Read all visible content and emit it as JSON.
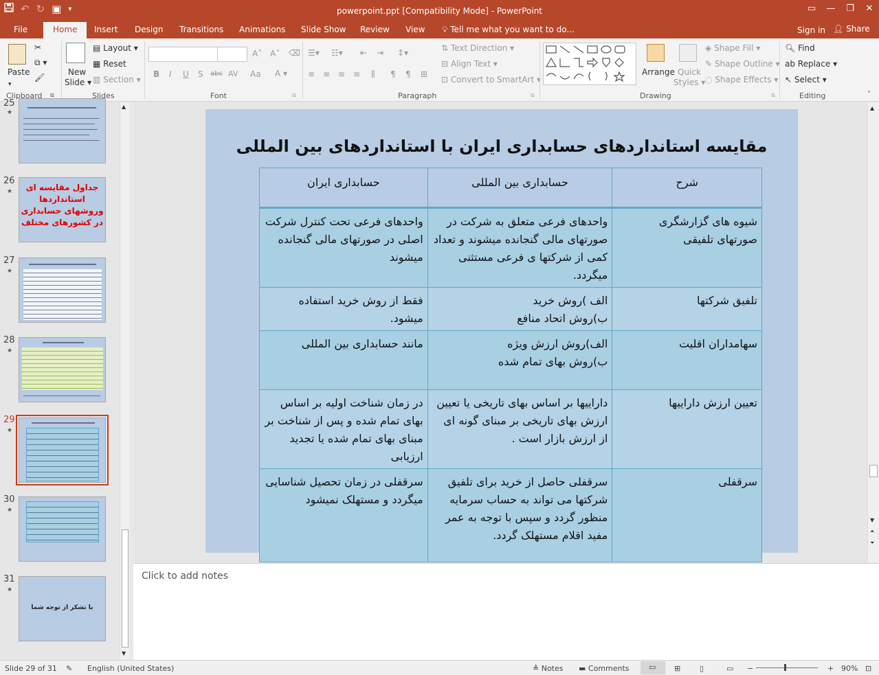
{
  "app": {
    "title": "powerpoint.ppt [Compatibility Mode] - PowerPoint",
    "accent": "#b7472a"
  },
  "qat": {
    "save_icon": "save-icon",
    "undo_icon": "undo-icon",
    "redo_icon": "redo-icon",
    "present_icon": "present-icon"
  },
  "tabs": {
    "file": "File",
    "home": "Home",
    "insert": "Insert",
    "design": "Design",
    "transitions": "Transitions",
    "animations": "Animations",
    "slideshow": "Slide Show",
    "review": "Review",
    "view": "View",
    "tell": "Tell me what you want to do...",
    "signin": "Sign in",
    "share": "Share"
  },
  "ribbon": {
    "clipboard": {
      "label": "Clipboard",
      "paste": "Paste"
    },
    "slides": {
      "label": "Slides",
      "new_slide_1": "New",
      "new_slide_2": "Slide",
      "layout": "Layout",
      "reset": "Reset",
      "section": "Section"
    },
    "font": {
      "label": "Font",
      "bold": "B",
      "italic": "I",
      "underline": "U",
      "strike": "S",
      "abc": "abc",
      "av": "AV",
      "aa": "Aa"
    },
    "paragraph": {
      "label": "Paragraph",
      "text_direction": "Text Direction",
      "align_text": "Align Text",
      "smartart": "Convert to SmartArt"
    },
    "drawing": {
      "label": "Drawing",
      "arrange": "Arrange",
      "quick_styles_1": "Quick",
      "quick_styles_2": "Styles",
      "shape_fill": "Shape Fill",
      "shape_outline": "Shape Outline",
      "shape_effects": "Shape Effects"
    },
    "editing": {
      "label": "Editing",
      "find": "Find",
      "replace": "Replace",
      "select": "Select"
    }
  },
  "thumbnails": [
    {
      "num": "25",
      "kind": "text"
    },
    {
      "num": "26",
      "kind": "red",
      "text": "جداول مقایسه ای استانداردها وروشهای حسابداری در کشورهای مختلف"
    },
    {
      "num": "27",
      "kind": "table"
    },
    {
      "num": "28",
      "kind": "table2"
    },
    {
      "num": "29",
      "kind": "current"
    },
    {
      "num": "30",
      "kind": "table3"
    },
    {
      "num": "31",
      "kind": "center",
      "text": "با تشکر از توجه شما"
    }
  ],
  "slide": {
    "title": "مقایسه استانداردهای حسابداری ایران با استانداردهای بین المللی",
    "headers": [
      "شرح",
      "حسابداری بین المللی",
      "حسابداری ایران"
    ],
    "rows": [
      [
        "شیوه های گزارشگری صورتهای تلفیقی",
        "واحدهای فرعی متعلق به شرکت در صورتهای مالی گنجانده میشوند و تعداد کمی از شرکتها ی فرعی مستثنی میگردد.",
        "واحدهای فرعی تحت کنترل شرکت اصلی در صورتهای مالی گنجانده میشوند"
      ],
      [
        "تلفیق شرکتها",
        "الف )روش خرید",
        "فقط از روش خرید استفاده میشود."
      ],
      [
        "سهامداران اقلیت",
        "الف)روش ارزش ویژه",
        "مانند حسابداری بین المللی"
      ],
      [
        "تعیین ارزش داراییها",
        "داراییها بر اساس بهای تاریخی یا تعیین ارزش بهای تاریخی بر مبنای گونه ای از ارزش بازار است .",
        "در زمان شناخت اولیه بر اساس بهای تمام شده و پس از شناخت بر مبنای بهای تمام شده یا تجدید ارزیابی"
      ],
      [
        "سرقفلی",
        "سرقفلی حاصل از خرید برای تلفیق شرکتها می تواند به حساب سرمایه منظور گردد و سپس با توجه به عمر مفید اقلام مستهلک گردد.",
        "سرقفلی در زمان تحصیل شناسایی میگردد و مستهلک نمیشود"
      ]
    ],
    "row2_line2": "ب)روش اتحاد منافع",
    "row3_line2": "ب)روش بهای تمام شده"
  },
  "notes_placeholder": "Click to add notes",
  "status": {
    "slide": "Slide 29 of 31",
    "language": "English (United States)",
    "notes": "Notes",
    "comments": "Comments",
    "zoom": "90%"
  }
}
